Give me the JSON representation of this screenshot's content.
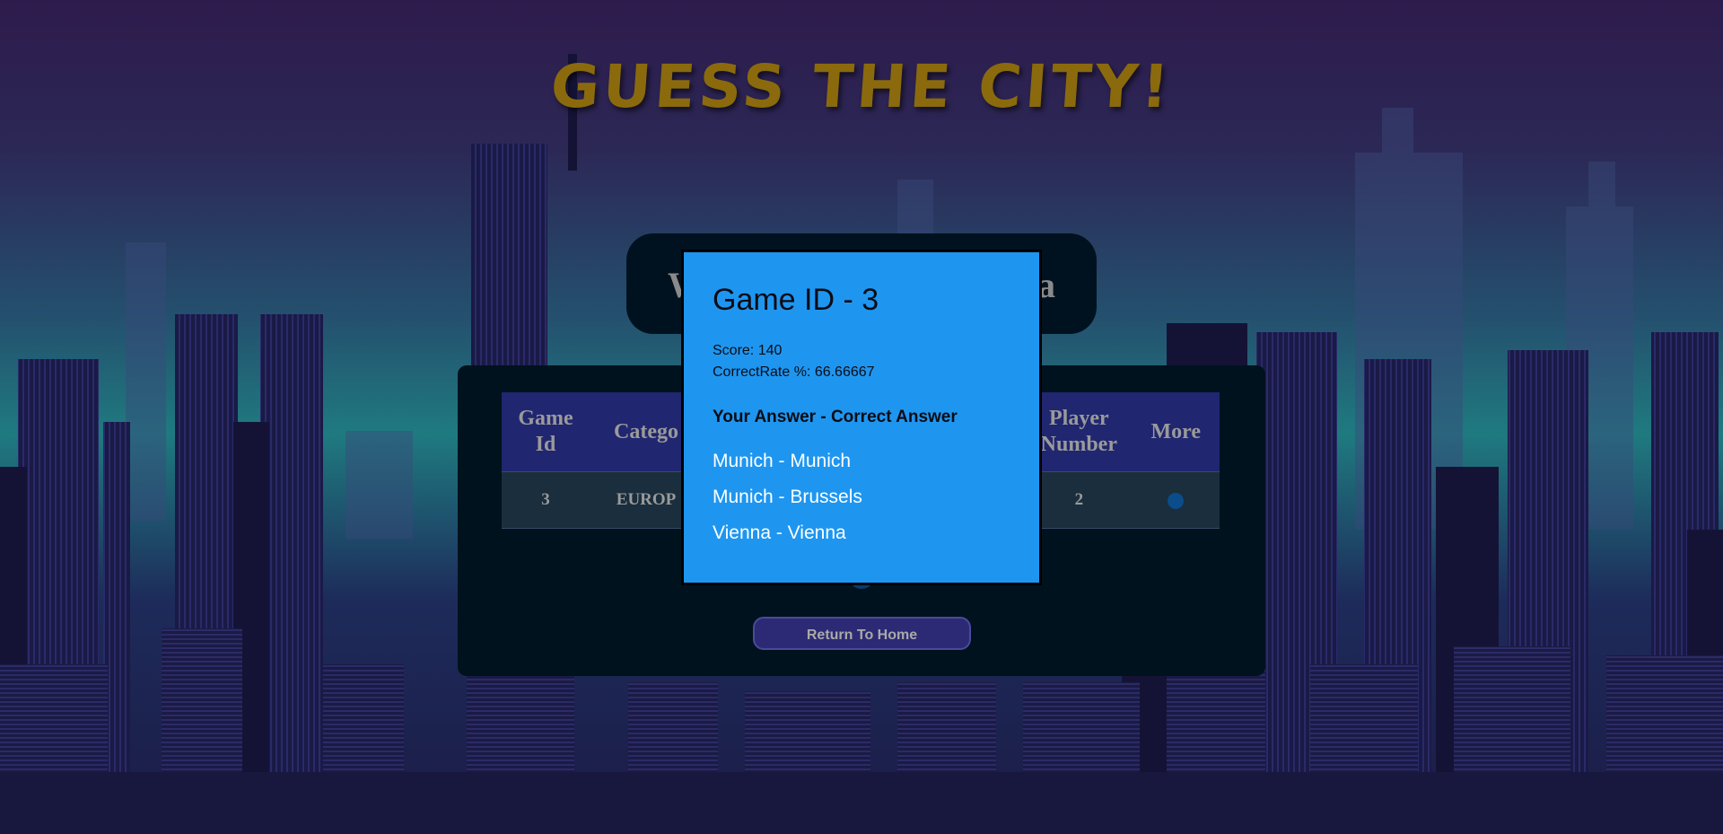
{
  "page": {
    "title": "GUESS THE CITY!"
  },
  "welcome": {
    "text_left": "W",
    "text_right": "a"
  },
  "history": {
    "headers": [
      "Game Id",
      "Catego",
      "Player Number",
      "More"
    ],
    "rows": [
      {
        "game_id": "3",
        "category": "EUROP",
        "player_number": "2"
      }
    ]
  },
  "actions": {
    "return_home": "Return To Home"
  },
  "modal": {
    "title": "Game ID - 3",
    "score": "Score: 140",
    "correct_rate": "CorrectRate %: 66.66667",
    "answers_header": "Your Answer - Correct Answer",
    "answers": [
      "Munich - Munich",
      "Munich - Brussels",
      "Vienna - Vienna"
    ]
  },
  "colors": {
    "title": "#8a6a0c",
    "modal_bg": "#1e96f0",
    "panel_bg": "#00121e",
    "table_header_bg": "#202670",
    "button_bg": "#2c2a74"
  }
}
